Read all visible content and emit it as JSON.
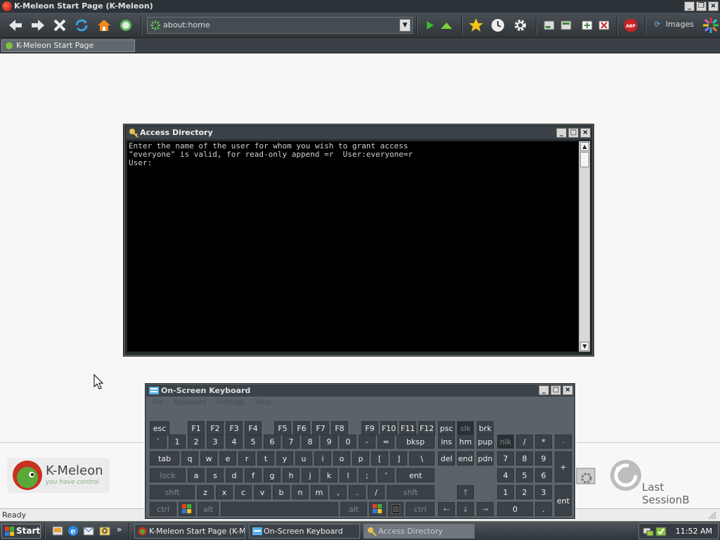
{
  "browser": {
    "title": "K-Meleon Start Page (K-Meleon)",
    "url": "about:home",
    "images_label": "Images",
    "tab_label": "K-Meleon Start Page",
    "status": "Ready"
  },
  "start_page": {
    "logo_name": "K-Meleon",
    "logo_tagline": "you have control",
    "session_label": "Last SessionB"
  },
  "cmd_window": {
    "title": "Access Directory",
    "line1": "Enter the name of the user for whom you wish to grant access",
    "line2": "\"everyone\" is valid, for read-only append =r  User:everyone=r",
    "line3": "User:"
  },
  "osk": {
    "title": "On-Screen Keyboard",
    "menu": [
      "File",
      "Keyboard",
      "Settings",
      "Help"
    ],
    "keys": {
      "esc": "esc",
      "f1": "F1",
      "f2": "F2",
      "f3": "F3",
      "f4": "F4",
      "f5": "F5",
      "f6": "F6",
      "f7": "F7",
      "f8": "F8",
      "f9": "F9",
      "f10": "F10",
      "f11": "F11",
      "f12": "F12",
      "psc": "psc",
      "slk": "slk",
      "brk": "brk",
      "grave": "`",
      "n1": "1",
      "n2": "2",
      "n3": "3",
      "n4": "4",
      "n5": "5",
      "n6": "6",
      "n7": "7",
      "n8": "8",
      "n9": "9",
      "n0": "0",
      "minus": "-",
      "equals": "=",
      "bksp": "bksp",
      "ins": "ins",
      "hm": "hm",
      "pup": "pup",
      "nlk": "nlk",
      "kdiv": "/",
      "kmul": "*",
      "ksub": "-",
      "tab": "tab",
      "q": "q",
      "w": "w",
      "e": "e",
      "r": "r",
      "t": "t",
      "y": "y",
      "u": "u",
      "i": "i",
      "o": "o",
      "p": "p",
      "lbr": "[",
      "rbr": "]",
      "bslash": "\\",
      "del": "del",
      "end": "end",
      "pdn": "pdn",
      "k7": "7",
      "k8": "8",
      "k9": "9",
      "kadd": "+",
      "lock": "lock",
      "a": "a",
      "s": "s",
      "d": "d",
      "f": "f",
      "g": "g",
      "h": "h",
      "j": "j",
      "k": "k",
      "l": "l",
      "semi": ";",
      "quote": "'",
      "ent": "ent",
      "k4": "4",
      "k5": "5",
      "k6": "6",
      "lshft": "shft",
      "z": "z",
      "x": "x",
      "c": "c",
      "v": "v",
      "b": "b",
      "n": "n",
      "m": "m",
      "comma": ",",
      "period": ".",
      "slash": "/",
      "rshft": "shft",
      "k1": "1",
      "k2": "2",
      "k3": "3",
      "kent": "ent",
      "lctrl": "ctrl",
      "lalt": "alt",
      "ralt": "alt",
      "rctrl": "ctrl",
      "k0": "0",
      "kdot": "."
    }
  },
  "taskbar": {
    "start": "Start",
    "tasks": [
      "K-Meleon Start Page (K-M...",
      "On-Screen Keyboard",
      "Access Directory"
    ],
    "clock": "11:52 AM",
    "quicklaunch_overflow": "»"
  },
  "colors": {
    "chrome_dark": "#2f3539",
    "accent_yellow": "#f4c21a",
    "home_orange": "#f08a1c",
    "go_green": "#3cba2a",
    "abp_red": "#cc2222"
  }
}
